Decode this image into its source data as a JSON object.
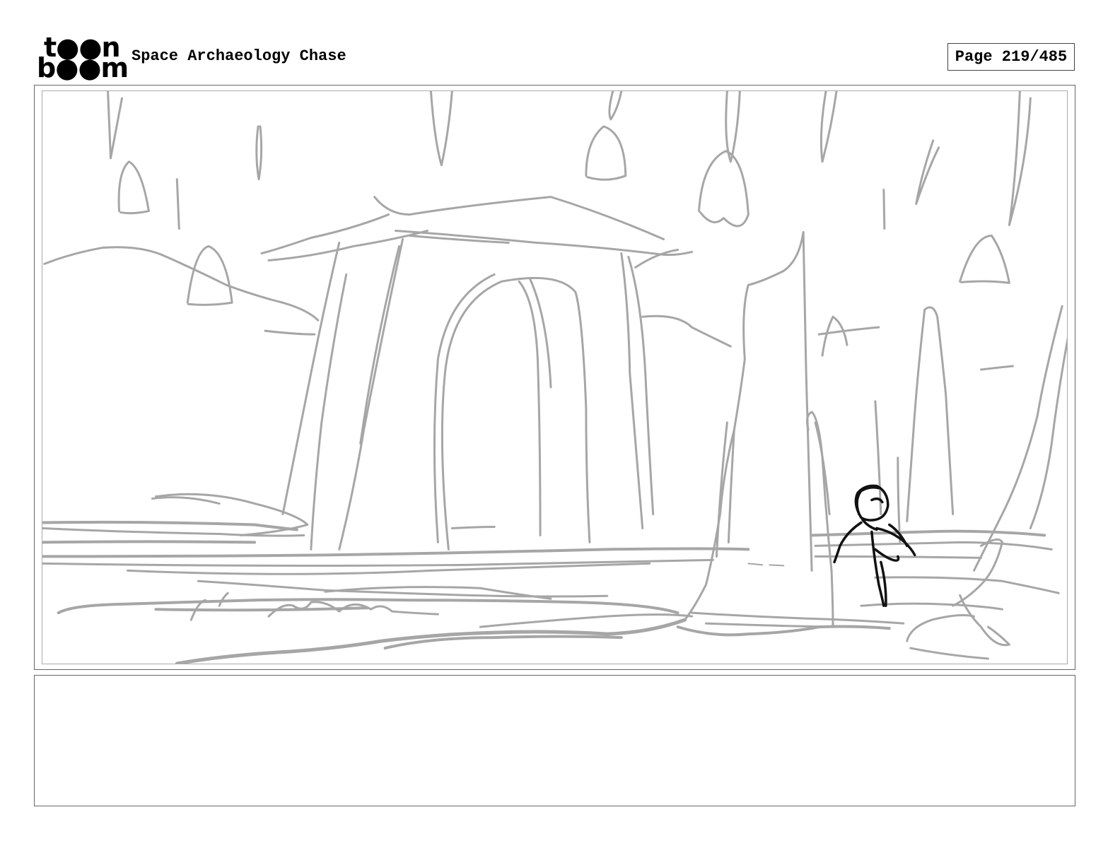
{
  "header": {
    "logo_top": "t●●n",
    "logo_bottom": "b●●m",
    "project_title": "Space Archaeology Chase",
    "page_indicator": "Page 219/485"
  },
  "panel": {
    "sketch_color": "#a6a6a6",
    "character_color": "#111111"
  },
  "notes": {
    "text": ""
  }
}
